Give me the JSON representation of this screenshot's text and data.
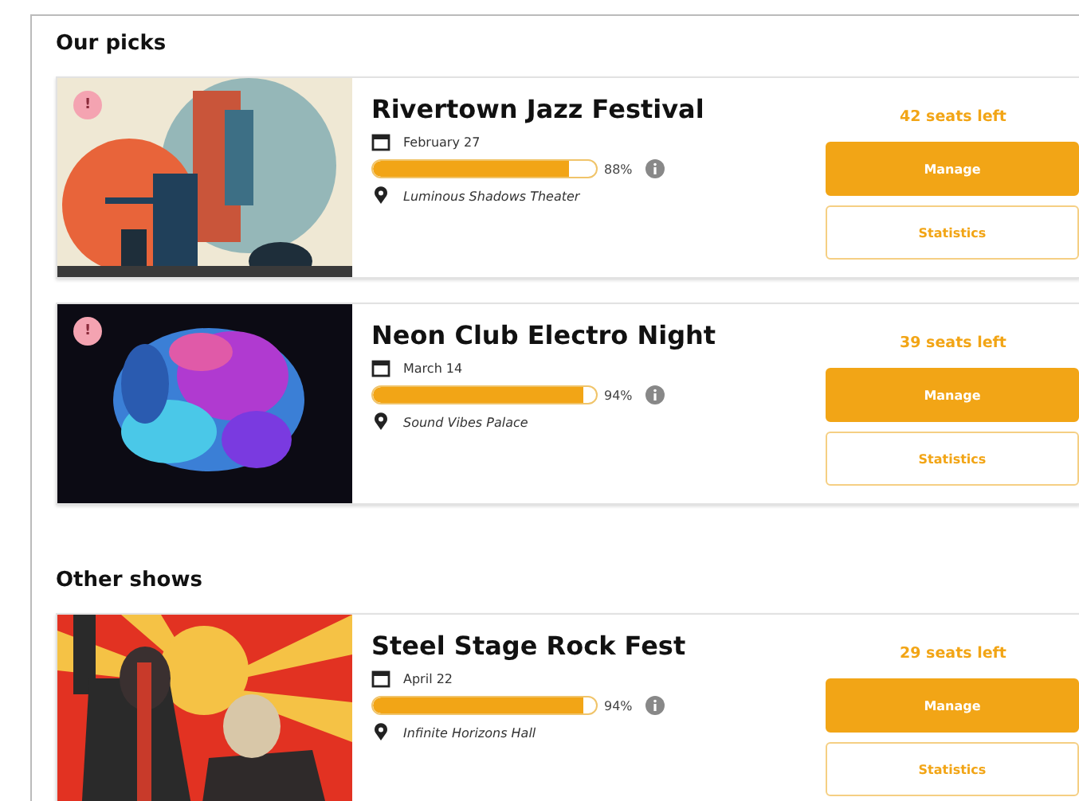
{
  "sections": [
    {
      "title": "Our picks",
      "events": [
        {
          "badge": "!",
          "name": "Rivertown Jazz Festival",
          "date": "February 27",
          "level": 0.88,
          "percent": "88%",
          "venue": "Luminous Shadows Theater",
          "seats": "42 seats left",
          "buttons": [
            "Manage",
            "Statistics"
          ]
        },
        {
          "badge": "!",
          "name": "Neon Club Electro Night",
          "date": "March 14",
          "level": 0.94,
          "percent": "94%",
          "venue": "Sound Vibes Palace",
          "seats": "39 seats left",
          "buttons": [
            "Manage",
            "Statistics"
          ]
        }
      ]
    },
    {
      "title": "Other shows",
      "events": [
        {
          "name": "Steel Stage Rock Fest",
          "date": "April 22",
          "level": 0.94,
          "percent": "94%",
          "venue": "Infinite Horizons Hall",
          "seats": "29 seats left",
          "buttons": [
            "Manage",
            "Statistics"
          ]
        }
      ]
    }
  ]
}
